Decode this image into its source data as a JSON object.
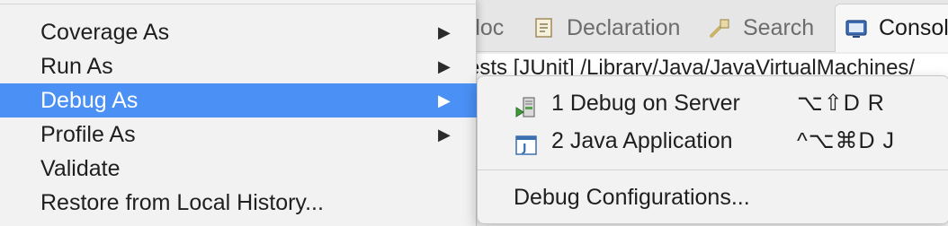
{
  "background": {
    "tabs": [
      {
        "label": "doc",
        "icon": "javadoc-icon"
      },
      {
        "label": "Declaration",
        "icon": "declaration-icon"
      },
      {
        "label": "Search",
        "icon": "search-icon"
      },
      {
        "label": "Consol",
        "icon": "console-icon"
      }
    ],
    "console_line": "ests [JUnit] /Library/Java/JavaVirtualMachines/"
  },
  "context_menu": {
    "items": [
      {
        "label": "Coverage As",
        "arrow": "▶",
        "active": false
      },
      {
        "label": "Run As",
        "arrow": "▶",
        "active": false
      },
      {
        "label": "Debug As",
        "arrow": "▶",
        "active": true
      },
      {
        "label": "Profile As",
        "arrow": "▶",
        "active": false
      },
      {
        "label": "Validate",
        "arrow": "",
        "active": false
      },
      {
        "label": "Restore from Local History...",
        "arrow": "",
        "active": false
      }
    ]
  },
  "submenu": {
    "items": [
      {
        "label": "1 Debug on Server",
        "shortcut": "⌥⇧D R",
        "icon": "debug-on-server-icon"
      },
      {
        "label": "2 Java Application",
        "shortcut": "^⌥⌘D J",
        "icon": "java-application-icon"
      },
      {
        "label": "Debug Configurations...",
        "shortcut": "",
        "icon": ""
      }
    ]
  },
  "colors": {
    "menu_bg": "#f2f2f2",
    "highlight": "#4a90f5",
    "highlight_text": "#ffffff"
  }
}
